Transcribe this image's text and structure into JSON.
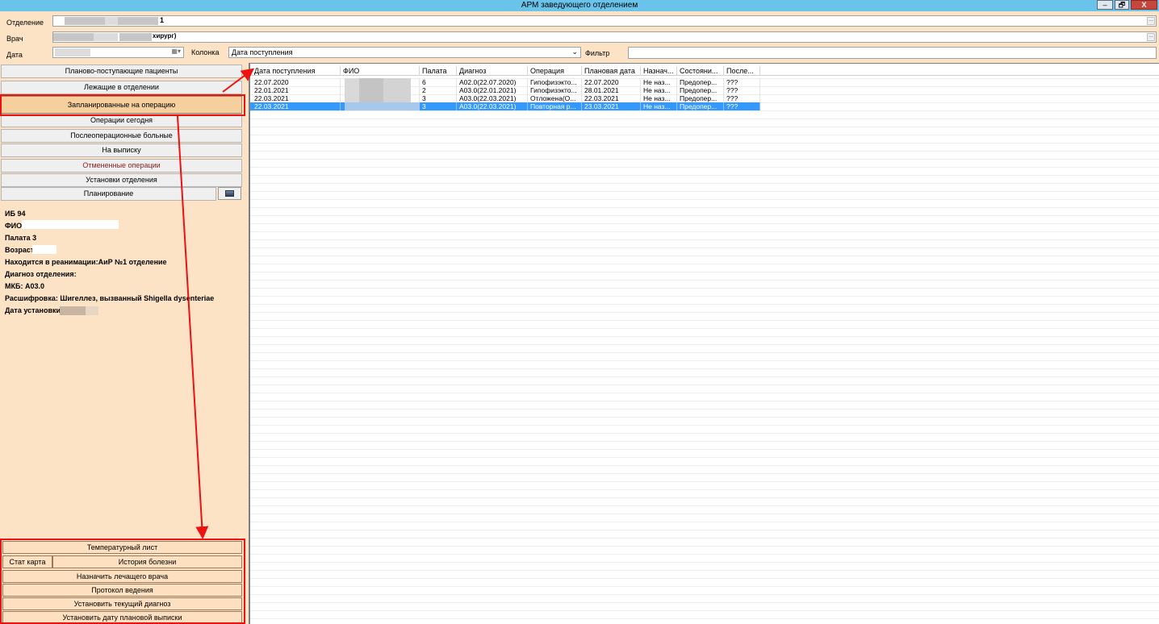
{
  "window": {
    "title": "АРМ заведующего отделением",
    "minimize": "–",
    "restore": "🗗",
    "close": "X"
  },
  "filters": {
    "department_label": "Отделение",
    "department_suffix": "1",
    "doctor_label": "Врач",
    "doctor_suffix": "хирург)",
    "date_label": "Дата",
    "column_label": "Колонка",
    "column_value": "Дата поступления",
    "filter_label": "Фильтр",
    "filter_value": ""
  },
  "nav": {
    "planned_incoming": "Планово-поступающие пациенты",
    "inpatients": "Лежащие в отделении",
    "scheduled_for_surgery": "Запланированные на операцию",
    "surgeries_today": "Операции сегодня",
    "postop": "Послеоперационные больные",
    "discharge": "На выписку",
    "cancelled": "Отмененные операции",
    "dept_settings": "Установки отделения",
    "planning": "Планирование"
  },
  "patient": {
    "ib": "ИБ 94",
    "fio_label": "ФИО",
    "ward": "Палата 3",
    "age_label": "Возраст",
    "icu": "Находится в реанимации:АиР №1 отделение",
    "dept_diagnosis": "Диагноз отделения:",
    "icd": "МКБ: А03.0",
    "decoding": "Расшифровка: Шигеллез, вызванный Shigella dysenteriae",
    "set_date_label": "Дата установки:"
  },
  "grid": {
    "columns": [
      "Дата поступления",
      "ФИО",
      "Палата",
      "Диагноз",
      "Операция",
      "Плановая дата",
      "Назнач...",
      "Состояни...",
      "После..."
    ],
    "rows": [
      {
        "admission": "22.07.2020",
        "fio": "",
        "ward": "6",
        "diagnosis": "A02.0(22.07.2020)",
        "operation": "Гипофизэкто...",
        "plan_date": "22.07.2020",
        "assigned": "Не наз...",
        "state": "Предопер...",
        "post": "???"
      },
      {
        "admission": "22.01.2021",
        "fio": "",
        "ward": "2",
        "diagnosis": "A03.0(22.01.2021)",
        "operation": "Гипофизэкто...",
        "plan_date": "28.01.2021",
        "assigned": "Не наз...",
        "state": "Предопер...",
        "post": "???"
      },
      {
        "admission": "22.03.2021",
        "fio": "",
        "ward": "3",
        "diagnosis": "A03.0(22.03.2021)",
        "operation": "Отложена(О...",
        "plan_date": "22.03.2021",
        "assigned": "Не наз...",
        "state": "Предопер...",
        "post": "???"
      },
      {
        "admission": "22.03.2021",
        "fio": "",
        "ward": "3",
        "diagnosis": "A03.0(22.03.2021)",
        "operation": "Повторная р...",
        "plan_date": "23.03.2021",
        "assigned": "Не наз...",
        "state": "Предопер...",
        "post": "???"
      }
    ]
  },
  "actions": {
    "temp_sheet": "Температурный лист",
    "stat_card": "Стат карта",
    "history": "История болезни",
    "assign_doctor": "Назначить лечащего врача",
    "protocol": "Протокол ведения",
    "set_diagnosis": "Установить текущий диагноз",
    "set_discharge": "Установить дату плановой выписки"
  },
  "colors": {
    "titlebar": "#6ac3ea",
    "panel": "#fde3c6",
    "selection": "#3399ff",
    "annotation": "#ee1111"
  }
}
